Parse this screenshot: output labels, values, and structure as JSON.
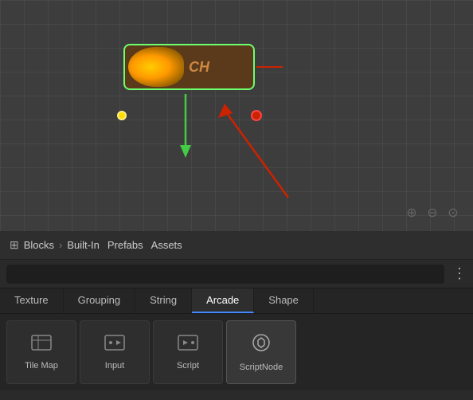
{
  "canvas": {
    "zoom_controls": [
      "+",
      "-",
      "⊙"
    ]
  },
  "breadcrumb": {
    "icon": "⊞",
    "items": [
      "Blocks",
      "Built-In",
      "Prefabs",
      "Assets"
    ]
  },
  "tabs": {
    "categories": [
      "Texture",
      "Grouping",
      "String",
      "Arcade",
      "Shape"
    ],
    "active": "Arcade"
  },
  "grid_items": [
    {
      "icon": "folder",
      "label": "Tile Map"
    },
    {
      "icon": "folder-arrow",
      "label": "Input"
    },
    {
      "icon": "folder-arrow-right",
      "label": "Script"
    },
    {
      "icon": "gear",
      "label": "ScriptNode"
    }
  ],
  "node": {
    "label": "CH"
  }
}
